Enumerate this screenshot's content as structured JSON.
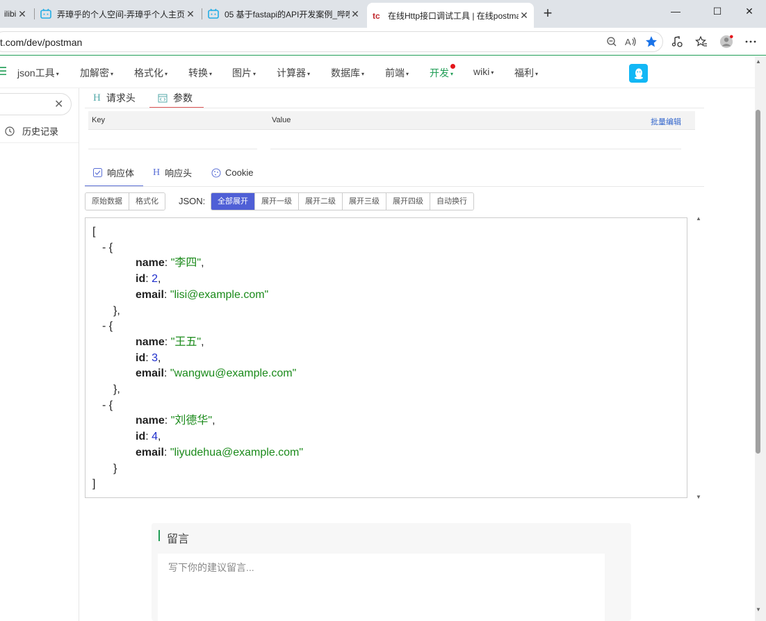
{
  "browser": {
    "tabs": [
      {
        "title": "ilibili"
      },
      {
        "title": "弄璋乎的个人空间-弄璋乎个人主页"
      },
      {
        "title": "05 基于fastapi的API开发案例_哔哩"
      },
      {
        "title": "在线Http接口调试工具 | 在线postman"
      }
    ],
    "new_tab": "+",
    "minimize": "—",
    "maximize": "☐",
    "close": "✕",
    "url": "t.com/dev/postman"
  },
  "nav": {
    "items": [
      {
        "label": "json工具"
      },
      {
        "label": "加解密"
      },
      {
        "label": "格式化"
      },
      {
        "label": "转换"
      },
      {
        "label": "图片"
      },
      {
        "label": "计算器"
      },
      {
        "label": "数据库"
      },
      {
        "label": "前端"
      },
      {
        "label": "开发"
      },
      {
        "label": "wiki"
      },
      {
        "label": "福利"
      }
    ]
  },
  "sidebar": {
    "history_label": "历史记录"
  },
  "request": {
    "tabs": [
      {
        "label": "请求头"
      },
      {
        "label": "参数"
      }
    ],
    "table": {
      "key_header": "Key",
      "value_header": "Value",
      "bulk_edit": "批量编辑"
    }
  },
  "response": {
    "tabs": [
      {
        "label": "响应体"
      },
      {
        "label": "响应头"
      },
      {
        "label": "Cookie"
      }
    ],
    "view_buttons": [
      "原始数据",
      "格式化"
    ],
    "json_label": "JSON:",
    "expand_buttons": [
      "全部展开",
      "展开一级",
      "展开二级",
      "展开三级",
      "展开四级",
      "自动换行"
    ],
    "json": [
      {
        "name": "李四",
        "id": 2,
        "email": "lisi@example.com"
      },
      {
        "name": "王五",
        "id": 3,
        "email": "wangwu@example.com"
      },
      {
        "name": "刘德华",
        "id": 4,
        "email": "liyudehua@example.com"
      }
    ]
  },
  "comment": {
    "title": "留言",
    "placeholder": "写下你的建议留言..."
  },
  "colors": {
    "accent": "#4f5fd6",
    "brand_green": "#1f9d55",
    "string": "#1a8a1a",
    "number": "#1f2fcc"
  }
}
